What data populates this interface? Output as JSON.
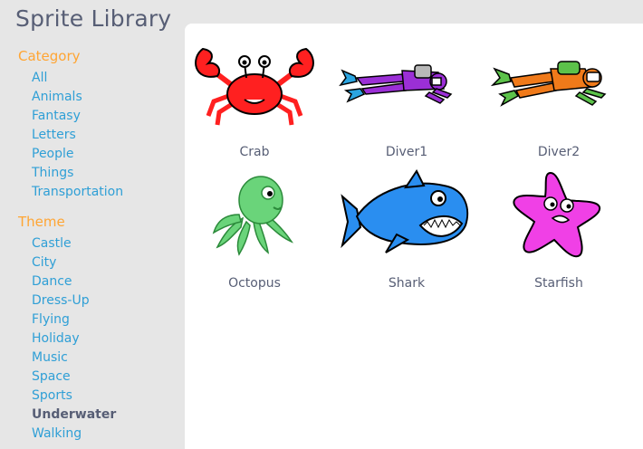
{
  "header": {
    "title": "Sprite Library"
  },
  "sidebar": {
    "category": {
      "heading": "Category",
      "items": [
        "All",
        "Animals",
        "Fantasy",
        "Letters",
        "People",
        "Things",
        "Transportation"
      ]
    },
    "theme": {
      "heading": "Theme",
      "items": [
        "Castle",
        "City",
        "Dance",
        "Dress-Up",
        "Flying",
        "Holiday",
        "Music",
        "Space",
        "Sports",
        "Underwater",
        "Walking"
      ],
      "selected": "Underwater"
    }
  },
  "sprites": [
    {
      "name": "Crab",
      "icon": "crab-icon"
    },
    {
      "name": "Diver1",
      "icon": "diver1-icon"
    },
    {
      "name": "Diver2",
      "icon": "diver2-icon"
    },
    {
      "name": "Octopus",
      "icon": "octopus-icon"
    },
    {
      "name": "Shark",
      "icon": "shark-icon"
    },
    {
      "name": "Starfish",
      "icon": "starfish-icon"
    }
  ],
  "colors": {
    "background": "#e6e6e6",
    "panel": "#ffffff",
    "heading_orange": "#ffa533",
    "link_blue": "#2f9fd6",
    "text_dark": "#575e75"
  }
}
